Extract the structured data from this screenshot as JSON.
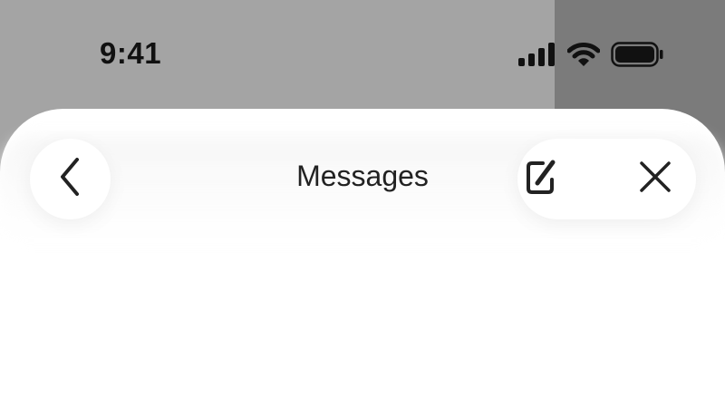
{
  "status_bar": {
    "time": "9:41",
    "icons": [
      "cellular-signal-icon",
      "wifi-icon",
      "battery-icon"
    ]
  },
  "nav": {
    "title": "Messages",
    "back_icon": "chevron-left-icon",
    "compose_icon": "compose-icon",
    "close_icon": "close-icon"
  },
  "colors": {
    "scrim_left": "#a4a4a4",
    "scrim_right": "#7b7b7b",
    "sheet": "#ffffff",
    "text": "#222222"
  }
}
